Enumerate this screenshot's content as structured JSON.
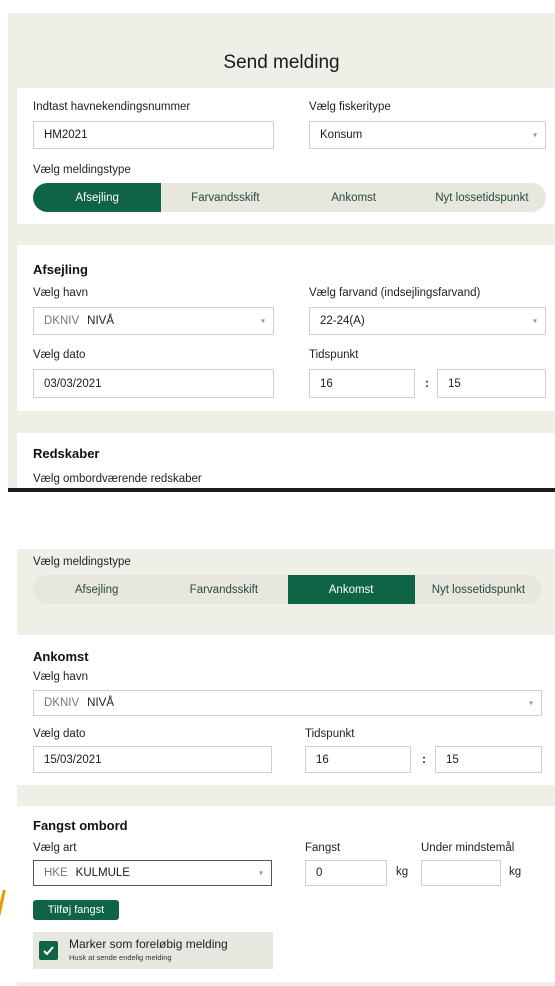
{
  "screen1": {
    "title": "Send melding",
    "harbor_id_label": "Indtast havnekendingsnummer",
    "harbor_id_value": "HM2021",
    "fishery_label": "Vælg fiskeritype",
    "fishery_value": "Konsum",
    "msgtype_label": "Vælg meldingstype",
    "tabs": [
      "Afsejling",
      "Farvandsskift",
      "Ankomst",
      "Nyt lossetidspunkt"
    ],
    "active_tab": 0,
    "section_title": "Afsejling",
    "port_label": "Vælg havn",
    "port_code": "DKNIV",
    "port_name": "NIVÅ",
    "water_label": "Vælg farvand (indsejlingsfarvand)",
    "water_value": "22-24(A)",
    "date_label": "Vælg dato",
    "date_value": "03/03/2021",
    "time_label": "Tidspunkt",
    "hour": "16",
    "minute": "15",
    "colon": ":",
    "gear_title": "Redskaber",
    "gear_label": "Vælg ombordværende redskaber"
  },
  "screen2": {
    "msgtype_label": "Vælg meldingstype",
    "tabs": [
      "Afsejling",
      "Farvandsskift",
      "Ankomst",
      "Nyt lossetidspunkt"
    ],
    "active_tab": 2,
    "section_title": "Ankomst",
    "port_label": "Vælg havn",
    "port_code": "DKNIV",
    "port_name": "NIVÅ",
    "date_label": "Vælg dato",
    "date_value": "15/03/2021",
    "time_label": "Tidspunkt",
    "hour": "16",
    "minute": "15",
    "colon": ":",
    "catch_title": "Fangst ombord",
    "species_label": "Vælg art",
    "species_code": "HKE",
    "species_name": "KULMULE",
    "catch_label": "Fangst",
    "catch_value": "0",
    "unit": "kg",
    "undersize_label": "Under mindstemål",
    "undersize_value": "",
    "add_catch_button": "Tilføj fangst",
    "prelim_label": "Marker som foreløbig melding",
    "prelim_hint": "Husk at sende endelig melding",
    "prelim_checked": true
  },
  "colors": {
    "accent": "#0f6445",
    "beige": "#efeee7"
  }
}
